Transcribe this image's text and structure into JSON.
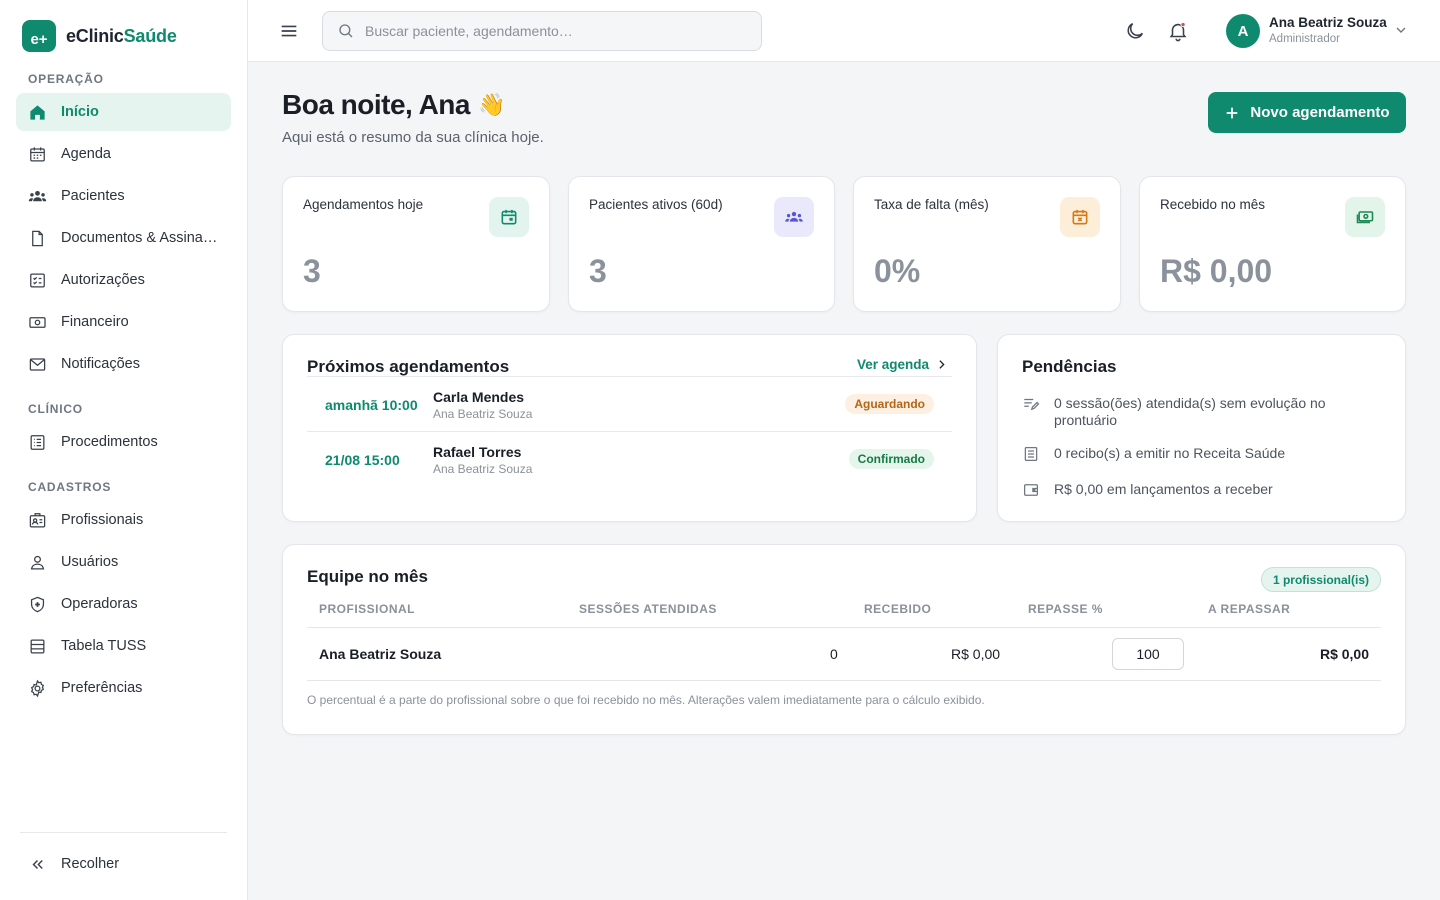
{
  "brand": {
    "logo": "e+",
    "name_part1": "eClinic",
    "name_part2": "Saúde",
    "color": "#0f8a6e"
  },
  "sidebar": {
    "sections": [
      {
        "label": "OPERAÇÃO"
      },
      {
        "label": "CLÍNICO"
      },
      {
        "label": "CADASTROS"
      }
    ],
    "items": [
      {
        "label": "Início",
        "icon": "home-icon",
        "active": true
      },
      {
        "label": "Agenda",
        "icon": "calendar-icon"
      },
      {
        "label": "Pacientes",
        "icon": "users-icon"
      },
      {
        "label": "Documentos & Assinaturas",
        "icon": "document-icon"
      },
      {
        "label": "Autorizações",
        "icon": "checklist-icon"
      },
      {
        "label": "Financeiro",
        "icon": "money-icon"
      },
      {
        "label": "Notificações",
        "icon": "mail-icon"
      },
      {
        "label": "Procedimentos",
        "icon": "list-icon"
      },
      {
        "label": "Profissionais",
        "icon": "id-badge-icon"
      },
      {
        "label": "Usuários",
        "icon": "user-icon"
      },
      {
        "label": "Operadoras",
        "icon": "shield-icon"
      },
      {
        "label": "Tabela TUSS",
        "icon": "table-icon"
      },
      {
        "label": "Preferências",
        "icon": "gear-icon"
      }
    ],
    "collapse_label": "Recolher"
  },
  "topbar": {
    "search_placeholder": "Buscar paciente, agendamento…",
    "user_initial": "A",
    "user_name": "Ana Beatriz Souza",
    "user_role": "Administrador"
  },
  "main": {
    "greeting": "Boa noite, Ana",
    "greeting_emoji": "👋",
    "subtitle": "Aqui está o resumo da sua clínica hoje.",
    "new_button": "Novo agendamento",
    "stats": [
      {
        "title": "Agendamentos hoje",
        "value": "3",
        "icon": "calendar-icon",
        "bg": "#e3f4ee",
        "fg": "#0f8a6e"
      },
      {
        "title": "Pacientes ativos (60d)",
        "value": "3",
        "icon": "users-icon",
        "bg": "#e9e9fb",
        "fg": "#5a55d6"
      },
      {
        "title": "Taxa de falta (mês)",
        "value": "0%",
        "icon": "calendar-x-icon",
        "bg": "#fdeed9",
        "fg": "#d37a12"
      },
      {
        "title": "Recebido no mês",
        "value": "R$ 0,00",
        "icon": "money-icon",
        "bg": "#e3f4ea",
        "fg": "#1f8a55"
      }
    ],
    "appointments": {
      "title": "Próximos agendamentos",
      "link": "Ver agenda",
      "rows": [
        {
          "time": "amanhã 10:00",
          "patient": "Carla Mendes",
          "professional": "Ana Beatriz Souza",
          "status": "Aguardando"
        },
        {
          "time": "21/08 15:00",
          "patient": "Rafael Torres",
          "professional": "Ana Beatriz Souza",
          "status": "Confirmado"
        }
      ]
    },
    "pending": {
      "title": "Pendências",
      "items": [
        {
          "text": "0 sessão(ões) atendida(s) sem evolução no prontuário",
          "icon": "edit-lines-icon"
        },
        {
          "text": "0 recibo(s) a emitir no Receita Saúde",
          "icon": "receipt-icon"
        },
        {
          "text": "R$ 0,00 em lançamentos a receber",
          "icon": "wallet-icon"
        }
      ]
    },
    "team": {
      "title": "Equipe no mês",
      "badge": "1 profissional(is)",
      "headers": [
        "PROFISSIONAL",
        "SESSÕES ATENDIDAS",
        "RECEBIDO",
        "REPASSE %",
        "A REPASSAR"
      ],
      "rows": [
        {
          "name": "Ana Beatriz Souza",
          "sessions": "0",
          "received": "R$ 0,00",
          "percent": "100",
          "payout": "R$ 0,00"
        }
      ],
      "note": "O percentual é a parte do profissional sobre o que foi recebido no mês. Alterações valem imediatamente para o cálculo exibido."
    }
  }
}
